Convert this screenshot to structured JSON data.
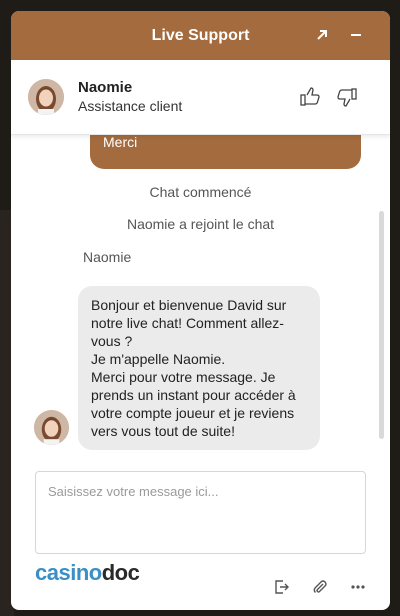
{
  "widget": {
    "header": {
      "title": "Live Support",
      "icons": [
        "expand-icon",
        "minimize-icon"
      ]
    },
    "agent": {
      "name": "Naomie",
      "role": "Assistance client"
    },
    "messages": {
      "user_bubble_text": "documents ?\nMerci",
      "system_started": "Chat commencé",
      "system_joined": "Naomie a rejoint le chat",
      "sender_label": "Naomie",
      "agent_bubble_text": "Bonjour et bienvenue David sur notre live chat! Comment allez-vous ?\nJe m'appelle Naomie.\nMerci pour votre message. Je prends un instant pour accéder à votre compte joueur et je reviens vers vous tout de suite!"
    },
    "composer": {
      "placeholder": "Saisissez votre message ici...",
      "value": ""
    },
    "brand": {
      "logo_text_a": "casino",
      "logo_text_b": "doc"
    },
    "footer_icons": [
      "exit-icon",
      "attachment-icon",
      "more-icon"
    ]
  },
  "colors": {
    "accent": "#a36b3e",
    "bubble_agent": "#ebebeb",
    "logo_blue": "#3a8fc4"
  }
}
